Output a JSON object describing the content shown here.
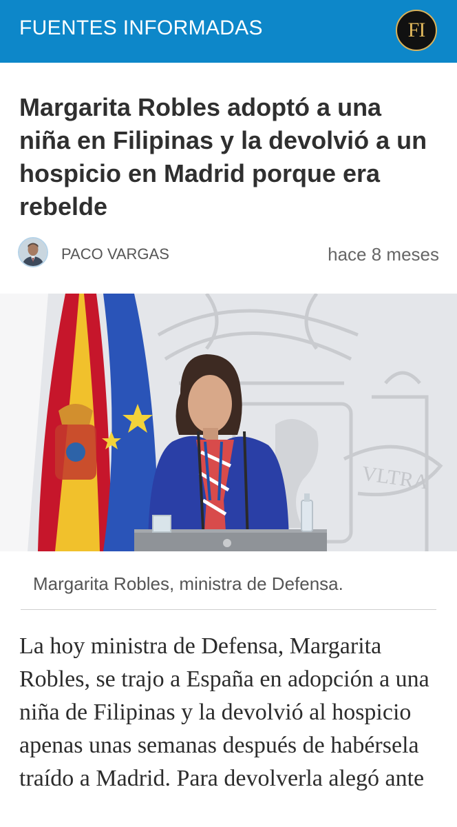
{
  "header": {
    "site_name": "FUENTES INFORMADAS",
    "logo_text": "FI",
    "brand_color": "#0d87c9",
    "logo_accent": "#e1b85c"
  },
  "article": {
    "title": "Margarita Robles adoptó a una niña en Filipinas y la devolvió a un hospicio en Madrid porque era rebelde",
    "author": "PACO VARGAS",
    "published": "hace 8 meses",
    "image_caption": "Margarita Robles, ministra de Defensa.",
    "body": "La hoy ministra de Defensa, Margarita Robles, se trajo a España en adopción a una niña de Filipinas y la devolvió al hospicio apenas unas semanas después de habérsela traído a Madrid. Para devolverla alegó ante"
  },
  "icons": {
    "author_avatar": "person-avatar-icon",
    "logo": "fi-logo-icon"
  }
}
